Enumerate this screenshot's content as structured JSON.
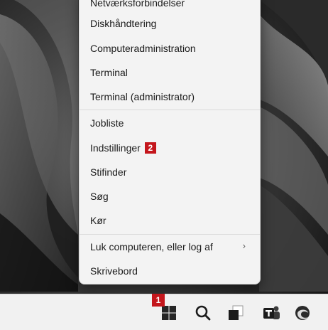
{
  "menu": {
    "items": [
      {
        "label": "Netværksforbindelser"
      },
      {
        "label": "Diskhåndtering"
      },
      {
        "label": "Computeradministration"
      },
      {
        "label": "Terminal"
      },
      {
        "label": "Terminal (administrator)"
      },
      {
        "label": "Jobliste"
      },
      {
        "label": "Indstillinger"
      },
      {
        "label": "Stifinder"
      },
      {
        "label": "Søg"
      },
      {
        "label": "Kør"
      },
      {
        "label": "Luk computeren, eller log af"
      },
      {
        "label": "Skrivebord"
      }
    ],
    "submenu_arrow": "›"
  },
  "annotations": {
    "badge_1": "1",
    "badge_2": "2",
    "color": "#c4161c"
  },
  "taskbar": {
    "icons": [
      "windows-start-icon",
      "search-icon",
      "task-view-icon",
      "teams-icon",
      "edge-icon"
    ]
  }
}
